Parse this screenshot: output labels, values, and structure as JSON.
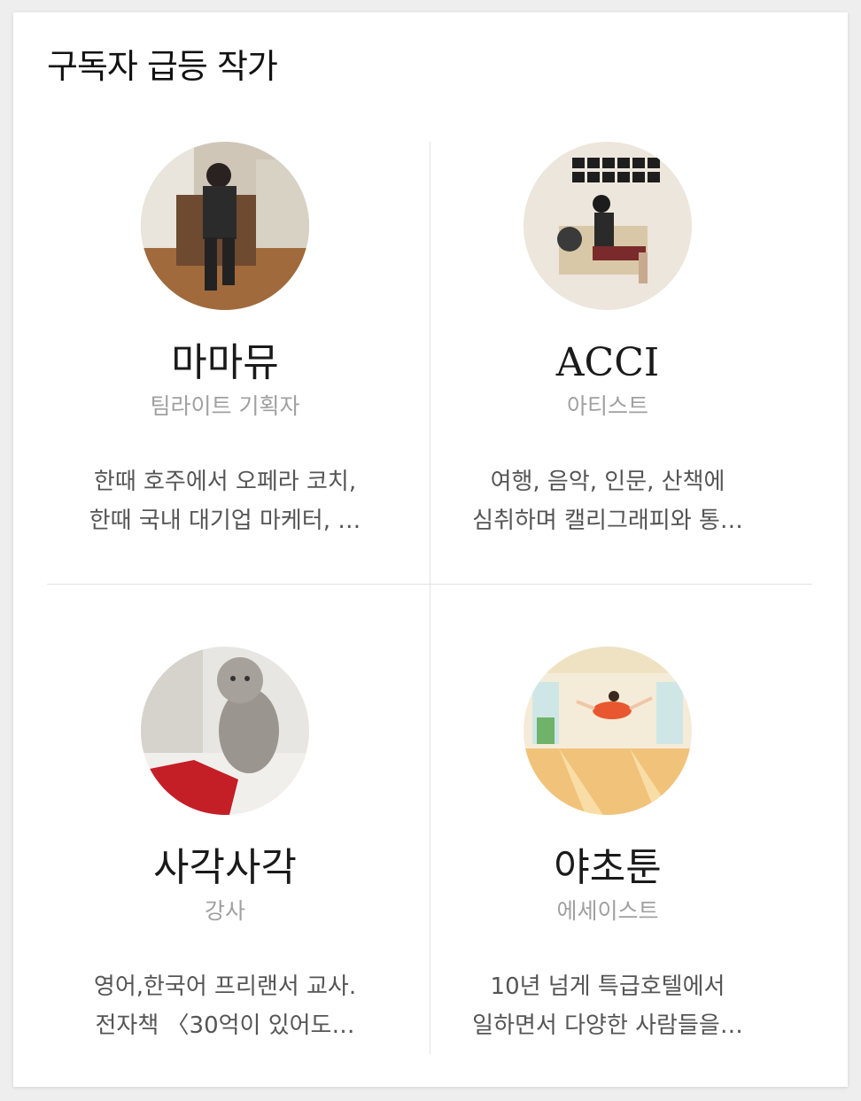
{
  "section": {
    "title": "구독자 급등 작가"
  },
  "authors": [
    {
      "name": "마마뮤",
      "job": "팀라이트 기획자",
      "desc_line1": "한때 호주에서 오페라 코치,",
      "desc_line2": "한때 국내 대기업 마케터, …"
    },
    {
      "name": "ACCI",
      "job": "아티스트",
      "desc_line1": "여행, 음악, 인문, 산책에",
      "desc_line2": "심취하며 캘리그래피와 통…"
    },
    {
      "name": "사각사각",
      "job": "강사",
      "desc_line1": "영어,한국어 프리랜서 교사.",
      "desc_line2": "전자책 〈30억이 있어도…"
    },
    {
      "name": "야초툰",
      "job": "에세이스트",
      "desc_line1": "10년 넘게 특급호텔에서",
      "desc_line2": "일하면서 다양한 사람들을…"
    }
  ]
}
